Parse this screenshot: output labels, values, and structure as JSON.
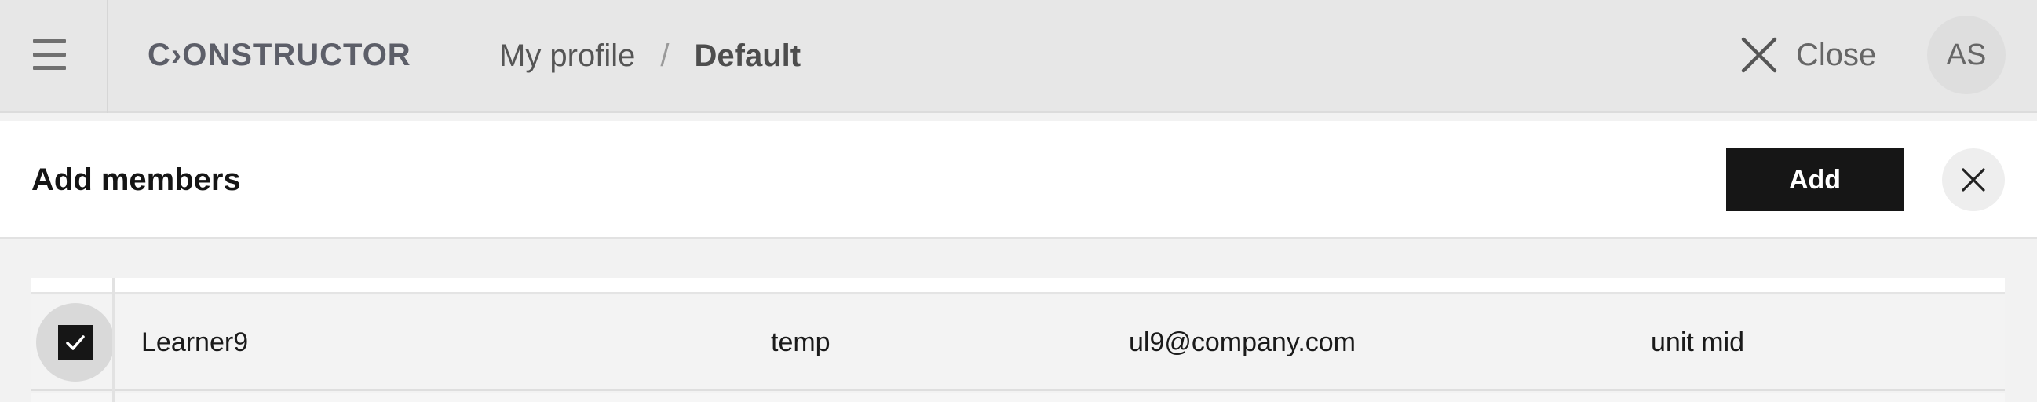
{
  "header": {
    "logo_text": "C›ONSTRUCTOR",
    "breadcrumb": [
      "My profile",
      "Default"
    ],
    "breadcrumb_separator": "/",
    "close_label": "Close",
    "avatar_initials": "AS"
  },
  "panel": {
    "title": "Add members",
    "add_button_label": "Add"
  },
  "table": {
    "rows": [
      {
        "selected": true,
        "name": "Learner9",
        "type": "temp",
        "email": "ul9@company.com",
        "unit": "unit mid"
      }
    ]
  },
  "colors": {
    "topbar_bg": "#e7e7e7",
    "panel_bg": "#ffffff",
    "primary_button": "#161616",
    "logo": "#5c5e68"
  },
  "icons": {
    "menu": "hamburger-icon",
    "close": "close-icon",
    "check": "checkmark-icon"
  }
}
